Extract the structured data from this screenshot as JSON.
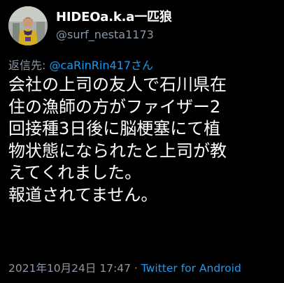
{
  "tweet": {
    "display_name": "HIDEOa.k.a一匹狼",
    "handle": "@surf_nesta1173",
    "reply_prefix": "返信先:",
    "reply_user": "@caRinRin417さん",
    "text": "会社の上司の友人で石川県在\n住の漁師の方がファイザー2\n回接種3日後に脳梗塞にて植\n物状態になられたと上司が教\nえてくれました。\n報道されてません。",
    "timestamp": "2021年10月24日 17:47",
    "separator": " · ",
    "source": "Twitter for Android"
  },
  "colors": {
    "background": "#000000",
    "primary_text": "#ffffff",
    "secondary_text": "#8b98a5",
    "link": "#1d9bf0"
  }
}
